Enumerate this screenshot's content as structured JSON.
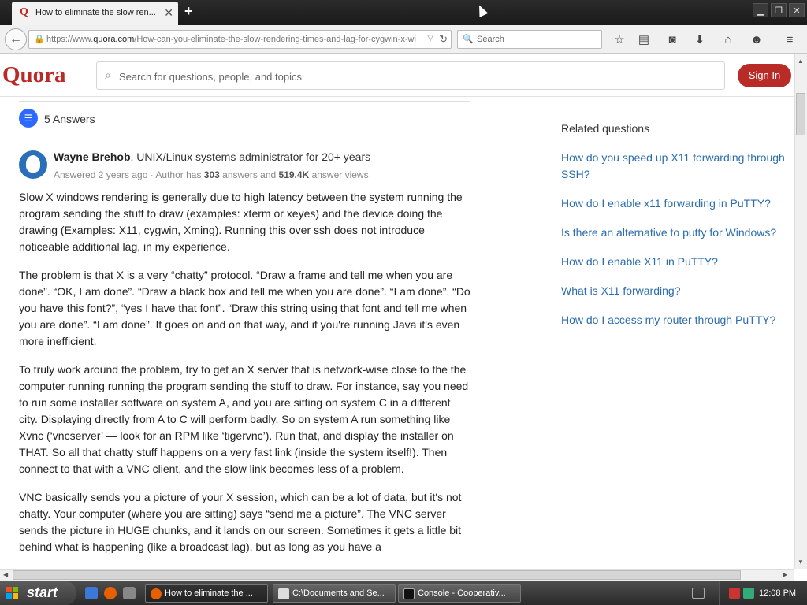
{
  "browser": {
    "tab": {
      "title": "How to eliminate the slow ren...",
      "favicon": "Q"
    },
    "url": {
      "prefix": "https://www.",
      "host": "quora.com",
      "path": "/How-can-you-eliminate-the-slow-rendering-times-and-lag-for-cygwin-x-wi"
    },
    "search_placeholder": "Search",
    "icons": [
      "back-arrow-icon",
      "lock-icon",
      "reload-icon",
      "search-icon",
      "bookmark-star-icon",
      "reader-icon",
      "pocket-icon",
      "download-icon",
      "home-icon",
      "chat-icon",
      "menu-icon"
    ]
  },
  "quora": {
    "logo": "Quora",
    "search_placeholder": "Search for questions, people, and topics",
    "signin_label": "Sign In"
  },
  "answers": {
    "count_label": "5 Answers",
    "author": {
      "name": "Wayne Brehob",
      "credential": ", UNIX/Linux systems administrator for 20+ years"
    },
    "meta": {
      "answered": "Answered 2 years ago · Author has ",
      "answers_count": "303",
      "answers_text": " answers and ",
      "views_count": "519.4K",
      "views_text": " answer views"
    },
    "paragraphs": [
      "Slow X windows rendering is generally due to high latency between the system running the program sending the stuff to draw (examples: xterm or xeyes) and the device doing the drawing (Examples: X11, cygwin, Xming). Running this over ssh does not introduce noticeable additional lag, in my experience.",
      "The problem is that X is a very “chatty” protocol. “Draw a frame and tell me when you are done”. “OK, I am done”. “Draw a black box and tell me when you are done”. “I am done”. “Do you have this font?”, “yes I have that font”. “Draw this string using that font and tell me when you are done”. “I am done”. It goes on and on that way, and if you're running Java it's even more inefficient.",
      "To truly work around the problem, try to get an X server that is network-wise close to the the computer running running the program sending the stuff to draw. For instance, say you need to run some installer software on system A, and you are sitting on system C in a different city. Displaying directly from A to C will perform badly. So on system A run something like Xvnc (‘vncserver’ — look for an RPM like ‘tigervnc’). Run that, and display the installer on THAT. So all that chatty stuff happens on a very fast link (inside the system itself!). Then connect to that with a VNC client, and the slow link becomes less of a problem.",
      "VNC basically sends you a picture of your X session, which can be a lot of data, but it's not chatty. Your computer (where you are sitting) says “send me a picture”. The VNC server sends the picture in HUGE chunks, and it lands on our screen. Sometimes it gets a little bit behind what is happening (like a broadcast lag), but as long as you have a"
    ]
  },
  "related": {
    "title": "Related questions",
    "items": [
      "How do you speed up X11 forwarding through SSH?",
      "How do I enable x11 forwarding in PuTTY?",
      "Is there an alternative to putty for Windows?",
      "How do I enable X11 in PuTTY?",
      "What is X11 forwarding?",
      "How do I access my router through PuTTY?"
    ]
  },
  "taskbar": {
    "start_label": "start",
    "tasks": [
      "How to eliminate the ...",
      "C:\\Documents and Se...",
      "Console - Cooperativ..."
    ],
    "clock": "12:08 PM"
  },
  "colors": {
    "quora_red": "#b92b27",
    "link_blue": "#2b6dad",
    "answers_blue": "#2e69ff"
  }
}
